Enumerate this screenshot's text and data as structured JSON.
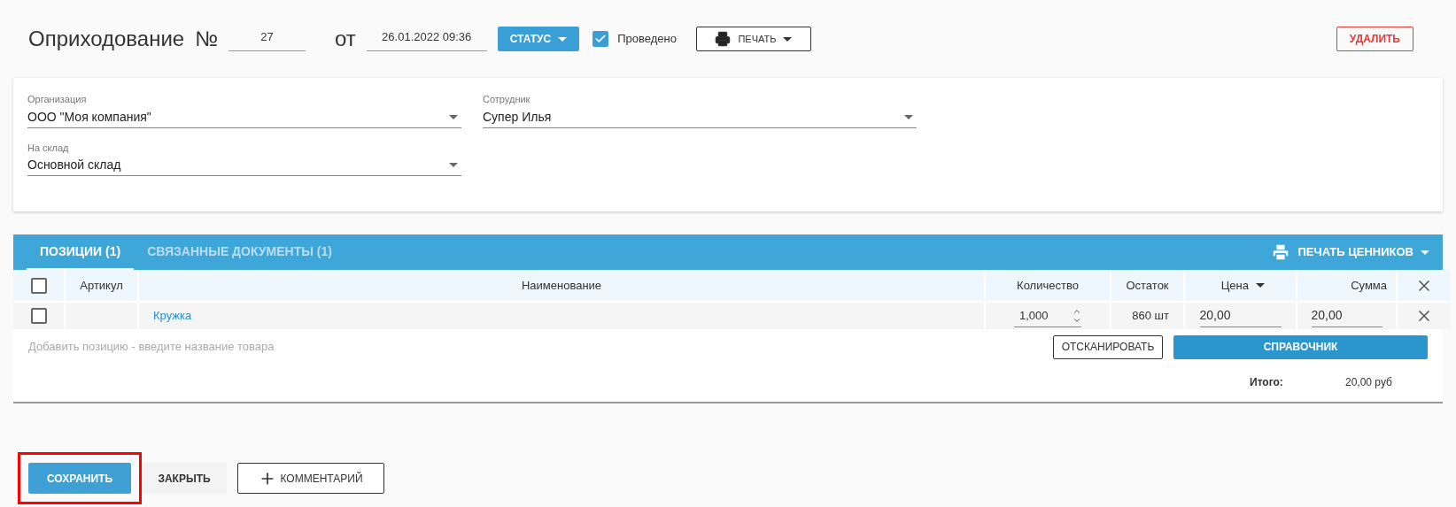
{
  "header": {
    "title": "Оприходование",
    "number_label": "№",
    "number": "27",
    "date_label": "от",
    "date": "26.01.2022 09:36",
    "status_button": "СТАТУС",
    "posted": {
      "label": "Проведено",
      "checked": true
    },
    "print_button": "ПЕЧАТЬ",
    "delete_button": "УДАЛИТЬ"
  },
  "form": {
    "fields": [
      {
        "label": "Организация",
        "value": "ООО \"Моя компания\""
      },
      {
        "label": "Сотрудник",
        "value": "Супер Илья"
      },
      {
        "label": "На склад",
        "value": "Основной склад"
      }
    ]
  },
  "tabs": [
    {
      "label": "ПОЗИЦИИ (1)",
      "selected": true
    },
    {
      "label": "СВЯЗАННЫЕ ДОКУМЕНТЫ (1)",
      "selected": false
    }
  ],
  "print_tags_button": "ПЕЧАТЬ ЦЕННИКОВ",
  "table": {
    "select_all_checked": false,
    "columns": [
      "Артикул",
      "Наименование",
      "Количество",
      "Остаток",
      "Цена",
      "Сумма"
    ],
    "rows": [
      {
        "checked": false,
        "article": "",
        "name": "Кружка",
        "quantity": "1,000",
        "stock": "860 шт",
        "price": "20,00",
        "sum": "20,00"
      }
    ]
  },
  "add_position": {
    "placeholder": "Добавить позицию - введите название товара"
  },
  "scan_button": "ОТСКАНИРОВАТЬ",
  "catalog_button": "СПРАВОЧНИК",
  "total": {
    "label": "Итого:",
    "value": "20,00 руб"
  },
  "footer": {
    "save_button": {
      "label": "СОХРАНИТЬ",
      "highlighted": true
    },
    "close_button": "ЗАКРЫТЬ",
    "comment_button": "КОММЕНТАРИЙ"
  }
}
